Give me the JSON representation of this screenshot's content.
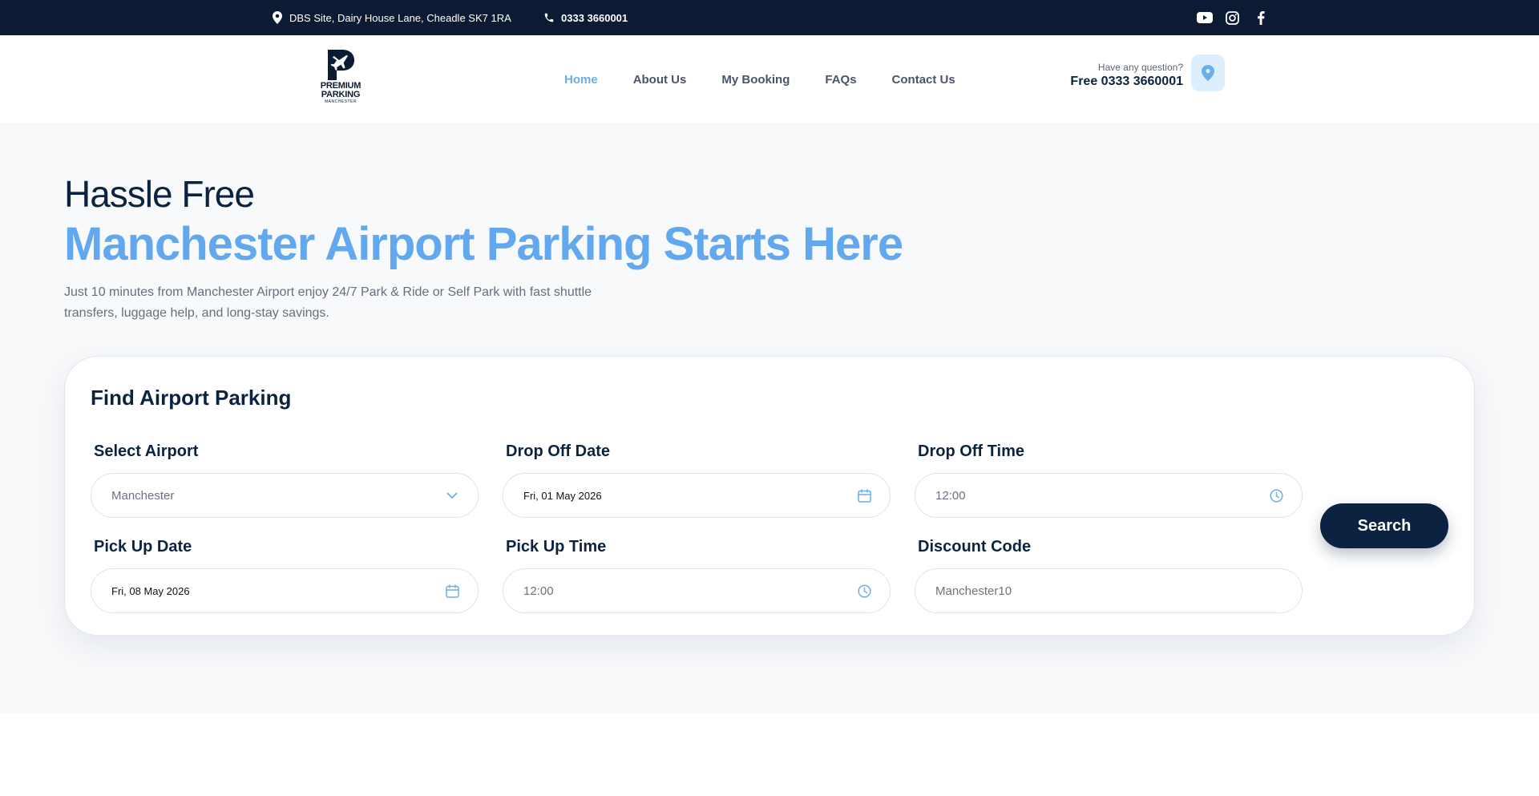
{
  "topbar": {
    "address": "DBS Site, Dairy House Lane, Cheadle SK7 1RA",
    "phone": "0333 3660001",
    "social": [
      "youtube-icon",
      "instagram-icon",
      "facebook-icon"
    ]
  },
  "logo": {
    "line1": "PREMIUM",
    "line2": "PARKING",
    "line3": "MANCHESTER"
  },
  "nav": {
    "items": [
      {
        "label": "Home",
        "active": true
      },
      {
        "label": "About Us"
      },
      {
        "label": "My Booking"
      },
      {
        "label": "FAQs"
      },
      {
        "label": "Contact Us"
      }
    ]
  },
  "contact": {
    "question": "Have any question?",
    "phone_line": "Free 0333 3660001",
    "icon": "map-pin-icon"
  },
  "hero": {
    "title_line1": "Hassle Free",
    "title_line2": "Manchester Airport Parking Starts Here",
    "description": "Just 10 minutes from Manchester Airport enjoy 24/7 Park & Ride or Self Park with fast shuttle transfers, luggage help, and long-stay savings."
  },
  "search_form": {
    "title": "Find Airport Parking",
    "fields": {
      "airport": {
        "label": "Select Airport",
        "value": "Manchester",
        "icon": "chevron-down-icon"
      },
      "dropoff_date": {
        "label": "Drop Off Date",
        "value": "Fri, 01 May 2026",
        "icon": "calendar-icon"
      },
      "dropoff_time": {
        "label": "Drop Off Time",
        "value": "12:00",
        "icon": "clock-icon"
      },
      "pickup_date": {
        "label": "Pick Up Date",
        "value": "Fri, 08 May 2026",
        "icon": "calendar-icon"
      },
      "pickup_time": {
        "label": "Pick Up Time",
        "value": "12:00",
        "icon": "clock-icon"
      },
      "discount_code": {
        "label": "Discount Code",
        "value": "Manchester10"
      }
    },
    "submit_label": "Search"
  },
  "colors": {
    "navy": "#0b1b33",
    "accent_blue": "#62a8ee",
    "hero_bg": "#f7f9fb"
  }
}
